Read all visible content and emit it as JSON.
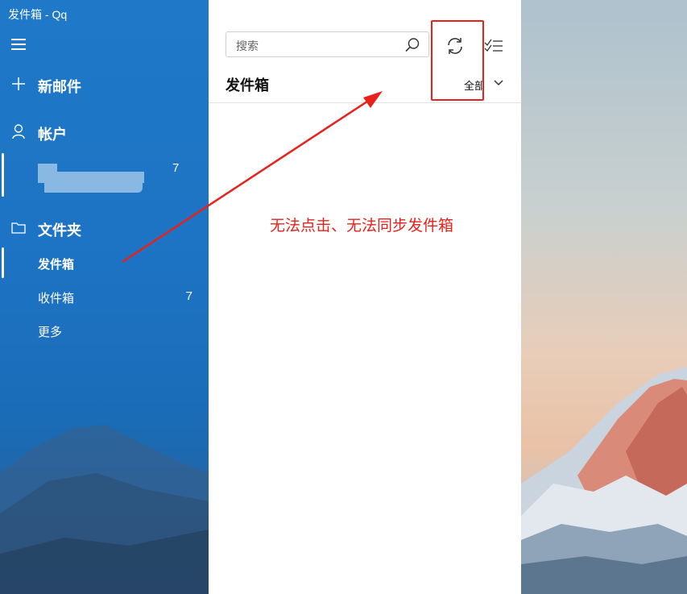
{
  "window": {
    "title": "发件箱 - Qq"
  },
  "nav": {
    "new_mail": "新邮件",
    "accounts": "帐户",
    "account_count": "7",
    "folders": "文件夹",
    "folder_items": [
      {
        "label": "发件箱",
        "count": "",
        "selected": true
      },
      {
        "label": "收件箱",
        "count": "7",
        "selected": false
      },
      {
        "label": "更多",
        "count": "",
        "selected": false
      }
    ],
    "icons": [
      "hamburger-icon",
      "plus-icon",
      "person-icon",
      "folder-icon"
    ]
  },
  "list": {
    "search_placeholder": "搜索",
    "folder_title": "发件箱",
    "filter_label": "全部",
    "icons": [
      "search-icon",
      "sync-icon",
      "select-mode-icon",
      "chevron-down-icon"
    ]
  },
  "annotation": {
    "text": "无法点击、无法同步发件箱",
    "color": "#e8211c"
  },
  "colors": {
    "nav_background": "#1d73c3",
    "annotation_red": "#e8211c"
  }
}
